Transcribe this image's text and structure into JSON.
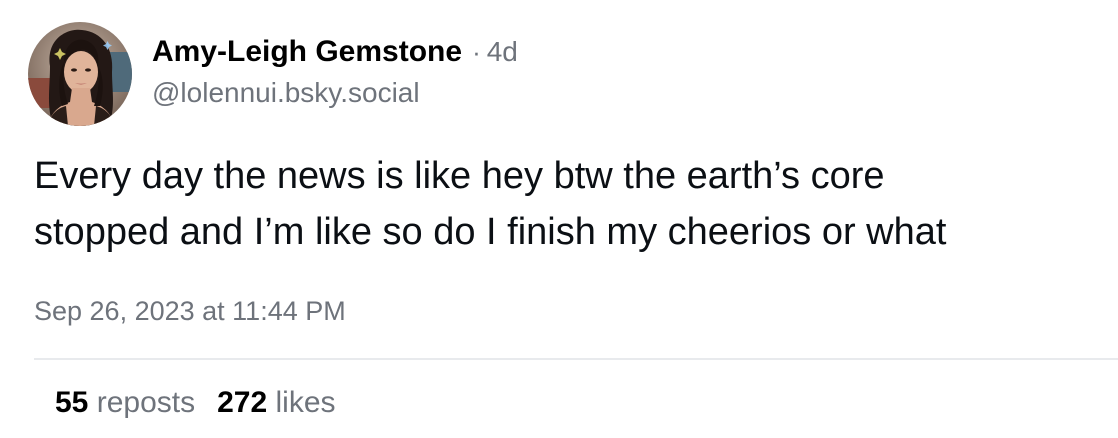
{
  "author": {
    "display_name": "Amy-Leigh Gemstone",
    "separator": "·",
    "post_age": "4d",
    "handle": "@lolennui.bsky.social",
    "avatar_icon": "user-avatar-photo"
  },
  "post": {
    "text": "Every day the news is like hey btw the earth’s core\nstopped and I’m like so do I finish my cheerios or what",
    "timestamp": "Sep 26, 2023 at 11:44 PM"
  },
  "stats": {
    "reposts_count": "55",
    "reposts_label": "reposts",
    "likes_count": "272",
    "likes_label": "likes"
  },
  "colors": {
    "text": "#0b0f14",
    "muted": "#6e737b",
    "divider": "#e8eaed",
    "background": "#ffffff"
  }
}
